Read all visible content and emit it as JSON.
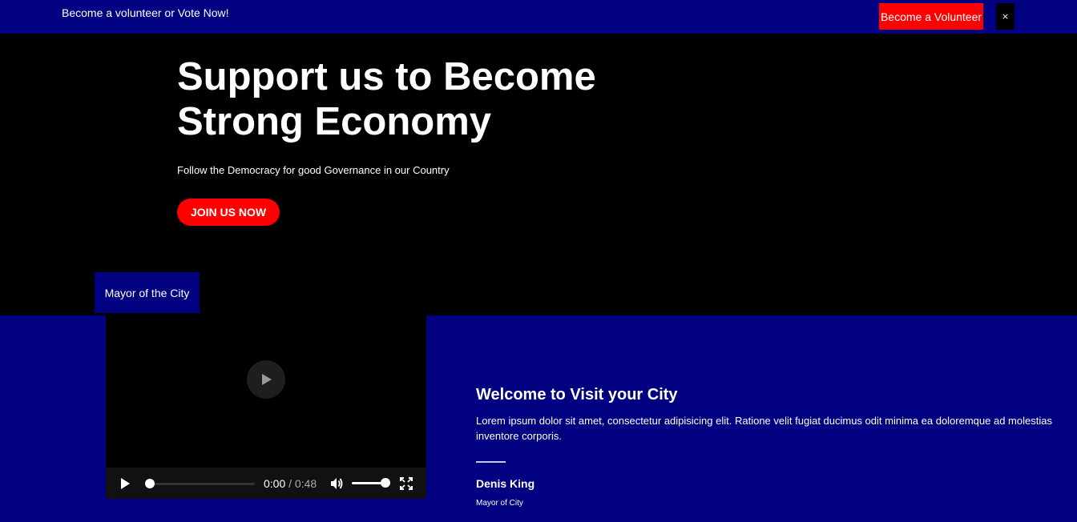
{
  "topbar": {
    "text": "Become a volunteer or Vote Now!",
    "volunteer_label": "Become a Volunteer",
    "close_label": "×"
  },
  "hero": {
    "title": "Support us to Become Strong Economy",
    "subtitle": "Follow the Democracy for good Governance in our Country",
    "cta_label": "JOIN US NOW"
  },
  "mayor_tag": "Mayor of the City",
  "video": {
    "current_time": "0:00",
    "separator": " / ",
    "duration": "0:48",
    "progress": 0,
    "volume": 1
  },
  "welcome": {
    "title": "Welcome to Visit your City",
    "text": "Lorem ipsum dolor sit amet, consectetur adipisicing elit. Ratione velit fugiat ducimus odit minima ea doloremque ad molestias inventore corporis.",
    "person_name": "Denis King",
    "person_role": "Mayor of City"
  },
  "colors": {
    "navy": "#000080",
    "accent_red": "#ff0000",
    "background": "#000000"
  },
  "icons": {
    "play": "play-icon",
    "volume": "volume-icon",
    "fullscreen": "fullscreen-icon",
    "close": "close-icon"
  }
}
